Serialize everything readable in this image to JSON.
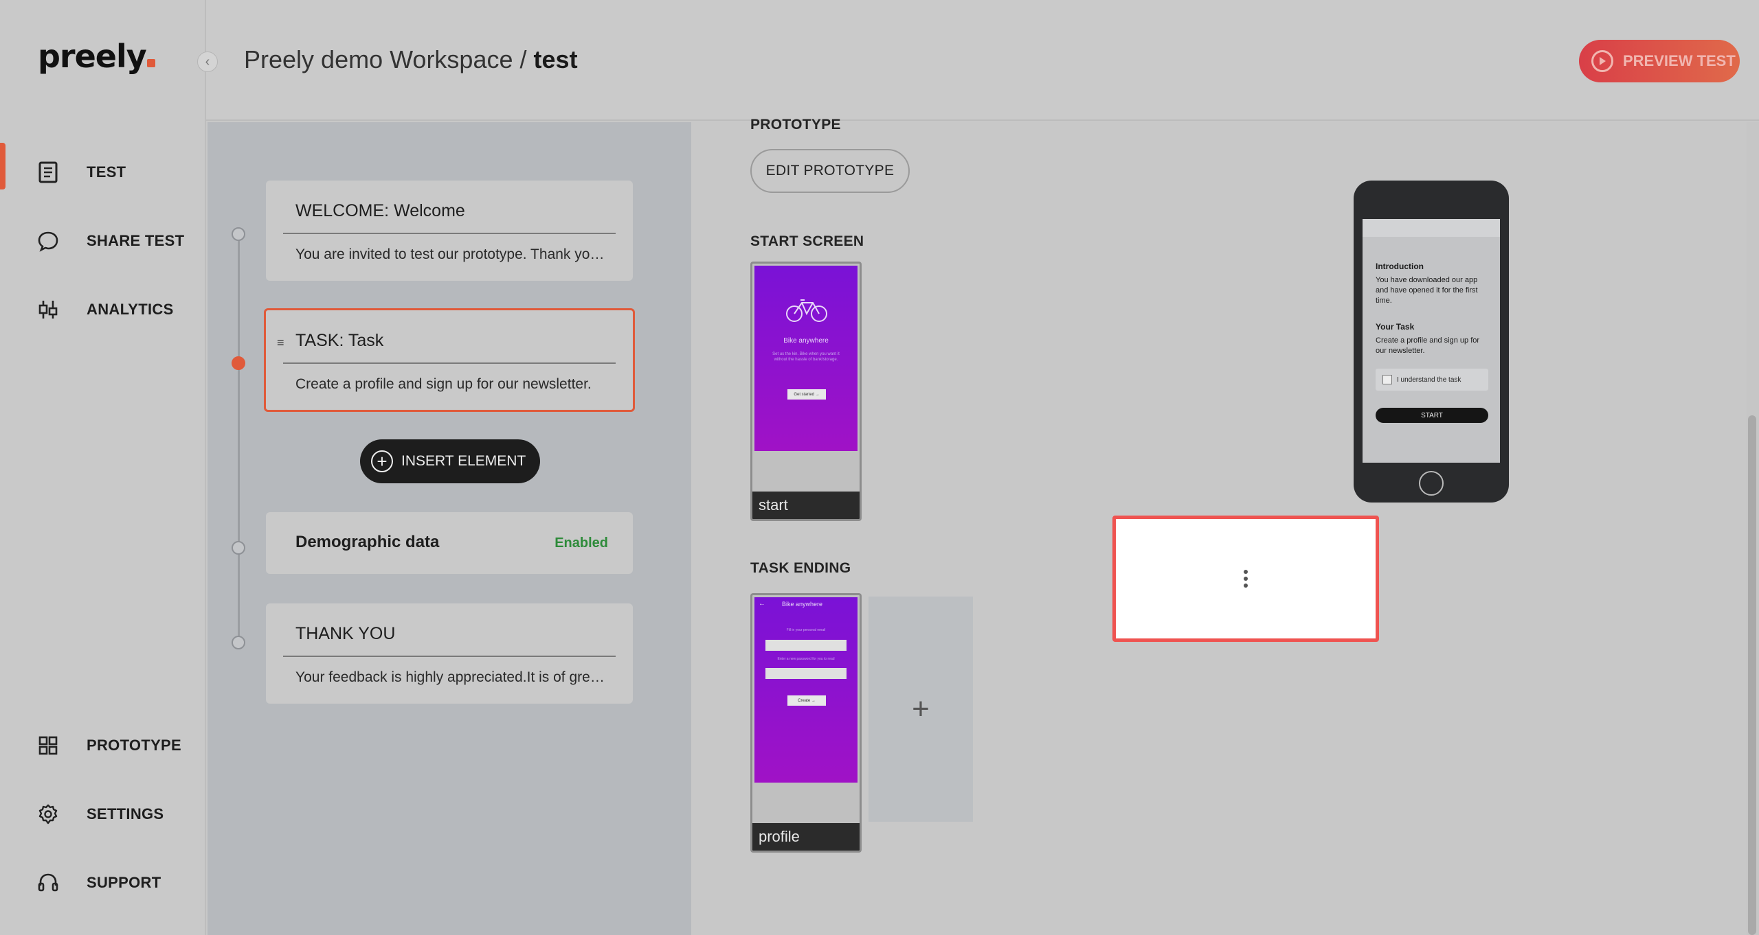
{
  "app": {
    "logo": "preely"
  },
  "sidebar": {
    "items": [
      {
        "label": "TEST",
        "icon": "document-icon",
        "active": true
      },
      {
        "label": "SHARE TEST",
        "icon": "chat-bubble-icon"
      },
      {
        "label": "ANALYTICS",
        "icon": "analytics-icon"
      }
    ],
    "bottom_items": [
      {
        "label": "PROTOTYPE",
        "icon": "grid-icon"
      },
      {
        "label": "SETTINGS",
        "icon": "gear-icon"
      },
      {
        "label": "SUPPORT",
        "icon": "headset-icon"
      }
    ]
  },
  "header": {
    "workspace": "Preely demo Workspace /",
    "test_name": "test",
    "preview_label": "PREVIEW TEST"
  },
  "flow": {
    "welcome": {
      "title": "WELCOME:  Welcome",
      "desc": "You are invited to test our prototype. Thank you for participating."
    },
    "task": {
      "title": "TASK:  Task",
      "handle": "≡",
      "desc": "Create a profile and sign up for our newsletter."
    },
    "insert_label": "INSERT ELEMENT",
    "demographic": {
      "title": "Demographic data",
      "status": "Enabled"
    },
    "thankyou": {
      "title": "THANK YOU",
      "desc": "Your feedback is highly appreciated.It is of great value to us."
    }
  },
  "main": {
    "prototype_label": "PROTOTYPE",
    "edit_prototype": "EDIT PROTOTYPE",
    "start_screen_label": "START SCREEN",
    "start_thumb": {
      "caption": "start",
      "title": "Bike anywhere",
      "sub": "Set us the kin. Bike when you want it without the hassle of bank/storage.",
      "btn": "Get started →"
    },
    "task_ending_label": "TASK ENDING",
    "end_thumb": {
      "caption": "profile",
      "title": "Bike anywhere",
      "field1": "Fill in your personal email",
      "field2": "Enter a new password for you to read",
      "btn": "Create →"
    },
    "add_symbol": "+"
  },
  "phone": {
    "intro_title": "Introduction",
    "intro_text": "You have downloaded our app and have opened it for the first time.",
    "task_title": "Your Task",
    "task_text": "Create a profile and sign up for our newsletter.",
    "checkbox_label": "I understand the task",
    "start_btn": "START"
  },
  "colors": {
    "accent": "#e05a3a",
    "popup_border": "#ef5350",
    "enabled": "#2e8b3a",
    "thumb_purple": "#8a12d0"
  }
}
